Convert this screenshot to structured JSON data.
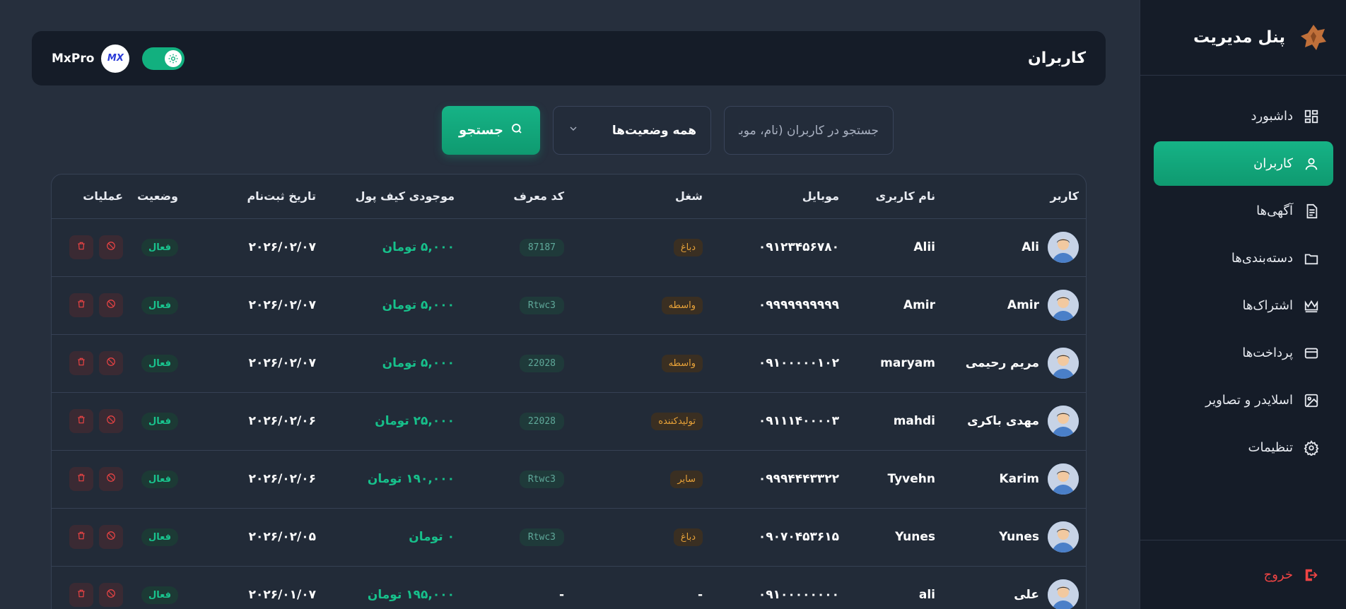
{
  "sidebar": {
    "title": "پنل مدیریت",
    "items": [
      {
        "label": "داشبورد",
        "icon": "dashboard-icon"
      },
      {
        "label": "کاربران",
        "icon": "user-icon",
        "active": true
      },
      {
        "label": "آگهی‌ها",
        "icon": "document-icon"
      },
      {
        "label": "دسته‌بندی‌ها",
        "icon": "folder-icon"
      },
      {
        "label": "اشتراک‌ها",
        "icon": "crown-icon"
      },
      {
        "label": "پرداخت‌ها",
        "icon": "wallet-icon"
      },
      {
        "label": "اسلایدر و تصاویر",
        "icon": "image-icon"
      },
      {
        "label": "تنظیمات",
        "icon": "gear-icon"
      }
    ],
    "logout_label": "خروج"
  },
  "header": {
    "title": "کاربران",
    "brand_name": "MxPro",
    "brand_logo_text": "MX",
    "theme_toggle_on": true
  },
  "filters": {
    "search_placeholder": "جستجو در کاربران (نام، موبایل)",
    "status_selected": "همه وضعیت‌ها",
    "search_button": "جستجو"
  },
  "table": {
    "headers": [
      "کاربر",
      "نام کاربری",
      "موبایل",
      "شغل",
      "کد معرف",
      "موجودی کیف پول",
      "تاریخ ثبت‌نام",
      "وضعیت",
      "عملیات"
    ],
    "rows": [
      {
        "name": "Ali",
        "username": "Alii",
        "mobile": "۰۹۱۲۳۴۵۶۷۸۰",
        "job": "دباغ",
        "ref": "87187",
        "wallet": "۵,۰۰۰ تومان",
        "date": "۲۰۲۶/۰۲/۰۷",
        "status": "فعال"
      },
      {
        "name": "Amir",
        "username": "Amir",
        "mobile": "۰۹۹۹۹۹۹۹۹۹۹",
        "job": "واسطه",
        "ref": "Rtwc3",
        "wallet": "۵,۰۰۰ تومان",
        "date": "۲۰۲۶/۰۲/۰۷",
        "status": "فعال"
      },
      {
        "name": "مریم رحیمی",
        "username": "maryam",
        "mobile": "۰۹۱۰۰۰۰۰۱۰۲",
        "job": "واسطه",
        "ref": "22028",
        "wallet": "۵,۰۰۰ تومان",
        "date": "۲۰۲۶/۰۲/۰۷",
        "status": "فعال"
      },
      {
        "name": "مهدی باکری",
        "username": "mahdi",
        "mobile": "۰۹۱۱۱۴۰۰۰۰۳",
        "job": "تولیدکننده",
        "ref": "22028",
        "wallet": "۲۵,۰۰۰ تومان",
        "date": "۲۰۲۶/۰۲/۰۶",
        "status": "فعال"
      },
      {
        "name": "Karim",
        "username": "Tyvehn",
        "mobile": "۰۹۹۹۴۴۴۳۳۲۲",
        "job": "سایر",
        "ref": "Rtwc3",
        "wallet": "۱۹۰,۰۰۰ تومان",
        "date": "۲۰۲۶/۰۲/۰۶",
        "status": "فعال"
      },
      {
        "name": "Yunes",
        "username": "Yunes",
        "mobile": "۰۹۰۷۰۴۵۳۶۱۵",
        "job": "دباغ",
        "ref": "Rtwc3",
        "wallet": "۰ تومان",
        "date": "۲۰۲۶/۰۲/۰۵",
        "status": "فعال"
      },
      {
        "name": "علی",
        "username": "ali",
        "mobile": "۰۹۱۰۰۰۰۰۰۰۰",
        "job": "-",
        "ref": "-",
        "wallet": "۱۹۵,۰۰۰ تومان",
        "date": "۲۰۲۶/۰۱/۰۷",
        "status": "فعال"
      }
    ]
  },
  "colors": {
    "accent": "#12b07f",
    "background": "#262f3d",
    "sidebar": "#151c28",
    "job_badge": "#e8a238",
    "danger": "#ef4444"
  }
}
